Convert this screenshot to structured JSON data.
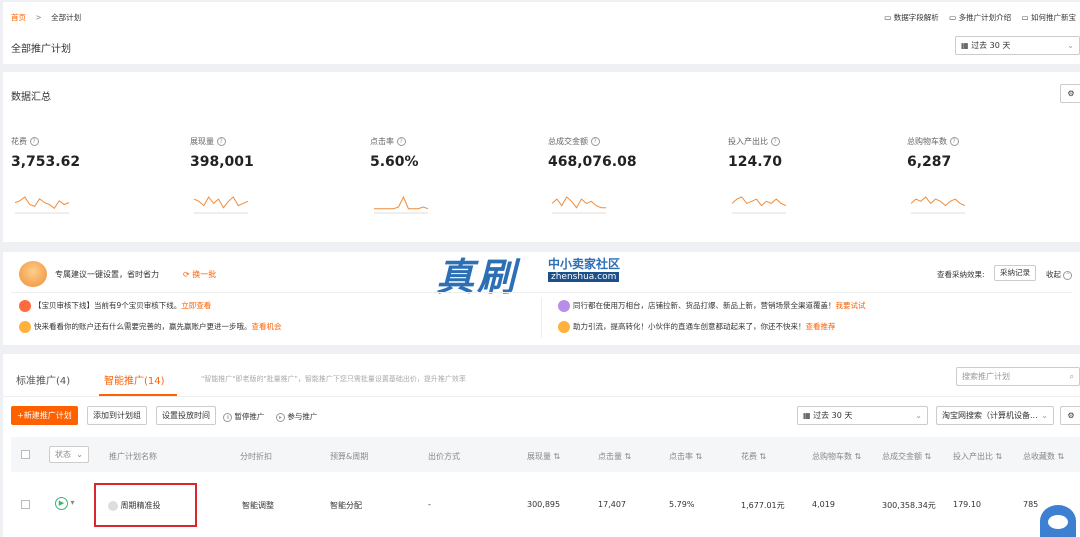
{
  "breadcrumb": {
    "home": "首页",
    "sep": ">",
    "current": "全部计划"
  },
  "top_links": [
    "数据字段解析",
    "多推广计划介绍",
    "如何推广新宝"
  ],
  "page_title": "全部推广计划",
  "date_range": "过去 30 天",
  "summary": {
    "title": "数据汇总",
    "metrics": [
      {
        "label": "花费",
        "value": "3,753.62"
      },
      {
        "label": "展现量",
        "value": "398,001"
      },
      {
        "label": "点击率",
        "value": "5.60%"
      },
      {
        "label": "总成交金额",
        "value": "468,076.08"
      },
      {
        "label": "投入产出比",
        "value": "124.70"
      },
      {
        "label": "总购物车数",
        "value": "6,287"
      }
    ]
  },
  "suggest": {
    "title": "专属建议一键设置，省时省力",
    "refresh": "换一批",
    "adopt_label": "查看采纳效果:",
    "adopt_button": "采纳记录",
    "collapse": "收起",
    "items": [
      {
        "tag": "【宝贝审核下线】",
        "text": "当前有9个宝贝审核下线。",
        "link": "立即查看"
      },
      {
        "tag": "",
        "text": "快来看看你的账户还有什么需要完善的，赢先赢账户更进一步哦。",
        "link": "查看机会"
      },
      {
        "tag": "",
        "text": "同行都在使用万相台，店铺拉新、货品打爆、新品上新，营销场景全渠道覆盖！",
        "link": "我要试试"
      },
      {
        "tag": "",
        "text": "助力引流，提高转化！小伙伴的直通车创意都动起来了，你还不快来！",
        "link": "查看推荐"
      }
    ]
  },
  "watermark": {
    "main": "真刷",
    "sub": "中小卖家社区",
    "url": "zhenshua.com"
  },
  "tabs": [
    {
      "label": "标准推广(4)"
    },
    {
      "label": "智能推广(14)"
    }
  ],
  "tabs_note": "\"智能推广\"即老版的\"批量推广\"，智能推广下您只需批量设置基础出价，提升推广效率",
  "search_placeholder": "搜索推广计划",
  "toolbar": {
    "new_plan": "+新建推广计划",
    "add_group": "添加到计划组",
    "set_time": "设置投放时间",
    "pause": "暂停推广",
    "join": "参与推广",
    "date": "过去 30 天",
    "channel": "淘宝网搜索（计算机设备..."
  },
  "table": {
    "headers": [
      "状态",
      "推广计划名称",
      "分时折扣",
      "预算&周期",
      "出价方式",
      "展现量",
      "点击量",
      "点击率",
      "花费",
      "总购物车数",
      "总成交金额",
      "投入产出比",
      "总收藏数"
    ],
    "row": {
      "name": "周期精准投",
      "discount": "智能调整",
      "budget": "智能分配",
      "bid": "-",
      "impressions": "300,895",
      "clicks": "17,407",
      "ctr": "5.79%",
      "cost": "1,677.01元",
      "cart": "4,019",
      "gmv": "300,358.34元",
      "roi": "179.10",
      "fav": "785"
    }
  },
  "colors": {
    "accent": "#ff6000",
    "link": "#ff6000",
    "blue": "#2c6fb5"
  },
  "sparklines": [
    [
      5,
      6,
      8,
      4,
      3,
      7,
      5,
      4,
      2,
      6,
      4,
      5
    ],
    [
      6,
      5,
      3,
      7,
      4,
      6,
      2,
      5,
      7,
      3,
      4,
      5
    ],
    [
      2,
      2,
      2,
      2,
      2,
      3,
      9,
      2,
      2,
      2,
      3,
      2
    ],
    [
      4,
      6,
      3,
      7,
      5,
      2,
      6,
      4,
      5,
      3,
      2,
      2
    ],
    [
      4,
      6,
      7,
      4,
      5,
      6,
      3,
      5,
      4,
      6,
      4,
      3
    ],
    [
      4,
      6,
      5,
      7,
      4,
      6,
      5,
      3,
      5,
      6,
      4,
      3
    ]
  ]
}
